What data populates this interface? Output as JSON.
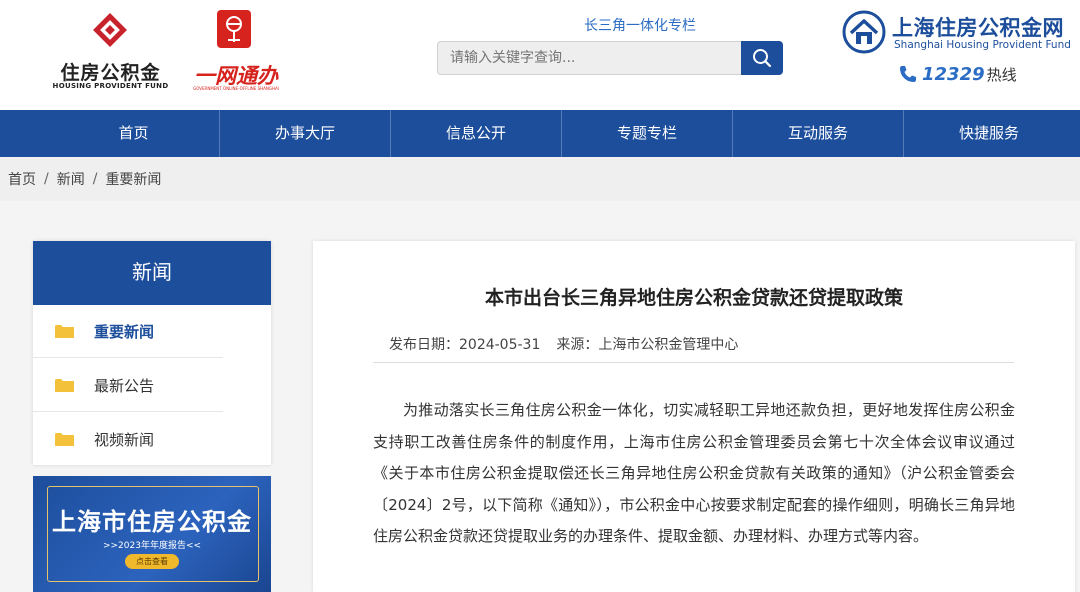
{
  "header": {
    "logo_left": {
      "title": "住房公积金",
      "subtitle": "HOUSING PROVIDENT FUND"
    },
    "logo_mid": {
      "title": "一网通办",
      "subtitle": "GOVERNMENT ONLINE-OFFLINE SHANGHAI"
    },
    "banner_link": "长三角一体化专栏",
    "search": {
      "placeholder": "请输入关键字查询..."
    },
    "logo_right": {
      "title": "上海住房公积金网",
      "subtitle": "Shanghai Housing Provident Fund"
    },
    "hotline": {
      "number": "12329",
      "label": "热线"
    }
  },
  "nav": {
    "items": [
      {
        "label": "首页"
      },
      {
        "label": "办事大厅"
      },
      {
        "label": "信息公开"
      },
      {
        "label": "专题专栏"
      },
      {
        "label": "互动服务"
      },
      {
        "label": "快捷服务"
      }
    ]
  },
  "breadcrumb": [
    "首页",
    "新闻",
    "重要新闻"
  ],
  "sidebar": {
    "title": "新闻",
    "items": [
      {
        "label": "重要新闻",
        "active": true
      },
      {
        "label": "最新公告",
        "active": false
      },
      {
        "label": "视频新闻",
        "active": false
      }
    ],
    "promo": {
      "title": "上海市住房公积金",
      "subtitle": ">>2023年年度报告<<",
      "button": "点击查看"
    }
  },
  "article": {
    "title": "本市出台长三角异地住房公积金贷款还贷提取政策",
    "publish_label": "发布日期：",
    "publish_date": "2024-05-31",
    "source_label": "来源：",
    "source": "上海市公积金管理中心",
    "body": "为推动落实长三角住房公积金一体化，切实减轻职工异地还款负担，更好地发挥住房公积金支持职工改善住房条件的制度作用，上海市住房公积金管理委员会第七十次全体会议审议通过《关于本市住房公积金提取偿还长三角异地住房公积金贷款有关政策的通知》（沪公积金管委会〔2024〕2号，以下简称《通知》），市公积金中心按要求制定配套的操作细则，明确长三角异地住房公积金贷款还贷提取业务的办理条件、提取金额、办理材料、办理方式等内容。"
  },
  "colors": {
    "primary": "#1d4e9c",
    "accent_red": "#d7231e",
    "link_blue": "#2b6cc4",
    "folder_yellow": "#f3c13a"
  }
}
